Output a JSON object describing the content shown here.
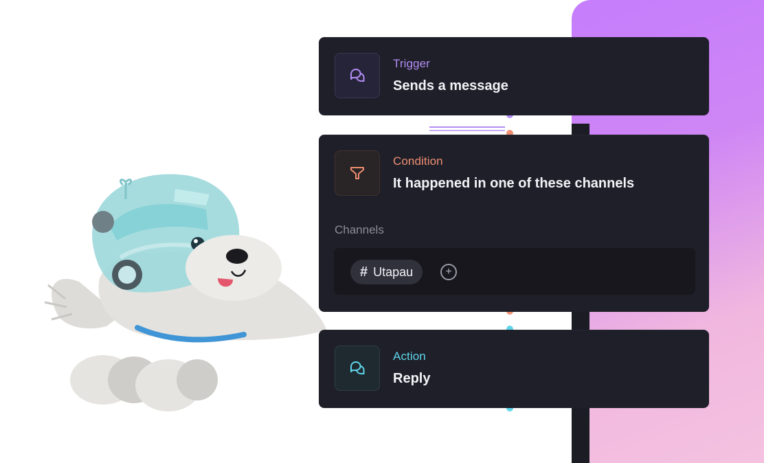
{
  "colors": {
    "trigger_accent": "#b28df4",
    "condition_accent": "#f08f73",
    "action_accent": "#5fd6ec",
    "card_background": "#1e1f28",
    "panel_gradient": [
      "#c57dfc",
      "#f4c2e0"
    ]
  },
  "trigger": {
    "kind": "Trigger",
    "title": "Sends a message",
    "icon": "chat-bubbles-icon"
  },
  "condition": {
    "kind": "Condition",
    "title": "It happened in one of these channels",
    "icon": "filter-funnel-icon",
    "channels_label": "Channels",
    "channels": [
      {
        "prefix": "#",
        "name": "Utapau"
      }
    ],
    "add_icon": "plus-circle-icon",
    "add_glyph": "+"
  },
  "action": {
    "kind": "Action",
    "title": "Reply",
    "icon": "chat-bubbles-icon"
  },
  "illustration": {
    "subject": "astronaut-dog-mascot"
  }
}
